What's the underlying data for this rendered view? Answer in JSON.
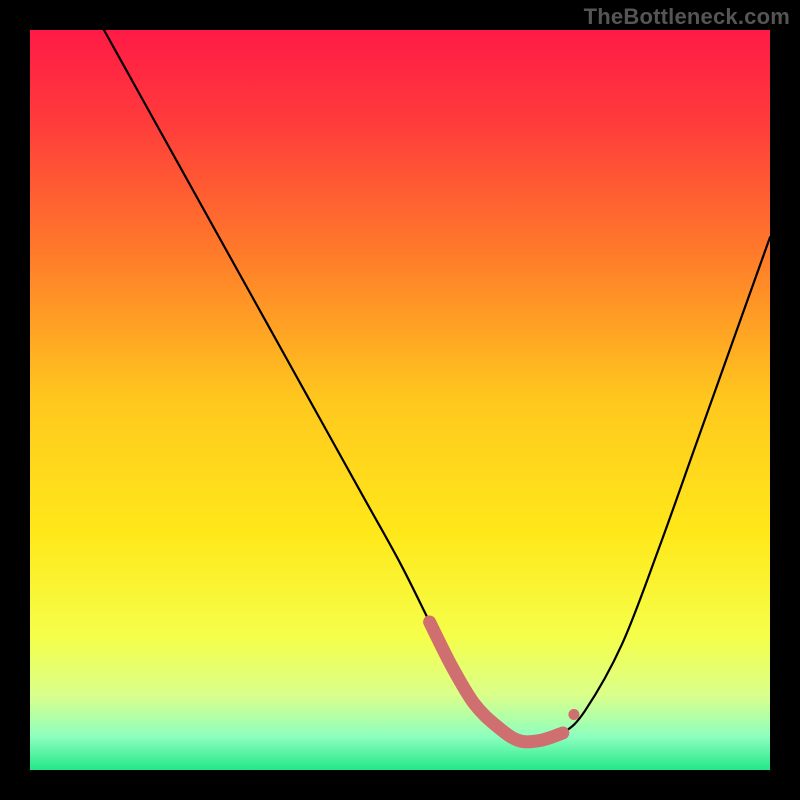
{
  "credit": "TheBottleneck.com",
  "colors": {
    "background": "#000000",
    "curve": "#000000",
    "marker_stroke": "#cf6f6f",
    "gradient_stops": [
      {
        "offset": 0.0,
        "color": "#ff1a46"
      },
      {
        "offset": 0.12,
        "color": "#ff3a3c"
      },
      {
        "offset": 0.3,
        "color": "#ff7a2a"
      },
      {
        "offset": 0.5,
        "color": "#ffc81e"
      },
      {
        "offset": 0.68,
        "color": "#ffe81a"
      },
      {
        "offset": 0.82,
        "color": "#f5ff4a"
      },
      {
        "offset": 0.9,
        "color": "#d9ff8c"
      },
      {
        "offset": 0.955,
        "color": "#8dffbf"
      },
      {
        "offset": 1.0,
        "color": "#22e787"
      }
    ]
  },
  "chart_data": {
    "type": "line",
    "title": "",
    "xlabel": "",
    "ylabel": "",
    "xlim": [
      0,
      100
    ],
    "ylim": [
      0,
      100
    ],
    "grid": false,
    "series": [
      {
        "name": "curve",
        "x": [
          10,
          15,
          20,
          25,
          30,
          35,
          40,
          45,
          50,
          54,
          57,
          60,
          63,
          66,
          69,
          72,
          75,
          80,
          85,
          90,
          95,
          100
        ],
        "y": [
          100,
          91,
          82,
          73,
          64,
          55,
          46,
          37,
          28,
          20,
          14,
          9,
          6,
          4,
          4,
          5,
          8,
          17,
          30,
          44,
          58,
          72
        ]
      }
    ],
    "highlight_range": {
      "x_start": 54,
      "x_end": 72,
      "note": "flat-bottom marker band near y≈4"
    }
  }
}
